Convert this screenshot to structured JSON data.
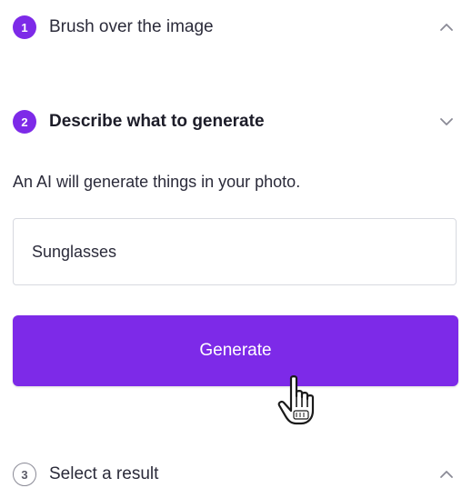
{
  "steps": [
    {
      "number": "1",
      "label": "Brush over the image",
      "state": "completed"
    },
    {
      "number": "2",
      "label": "Describe what to generate",
      "state": "active"
    },
    {
      "number": "3",
      "label": "Select a result",
      "state": "pending"
    }
  ],
  "describe": {
    "helper_text": "An AI will generate things in your photo.",
    "input_value": "Sunglasses",
    "button_label": "Generate"
  },
  "icons": {
    "step_1_toggle": "chevron-up-icon",
    "step_2_toggle": "chevron-down-icon",
    "step_3_toggle": "chevron-up-icon",
    "pointer": "hand-pointer-icon"
  },
  "colors": {
    "accent": "#7d2ae8",
    "text": "#2b2b3a",
    "border": "#d7d9e0"
  }
}
